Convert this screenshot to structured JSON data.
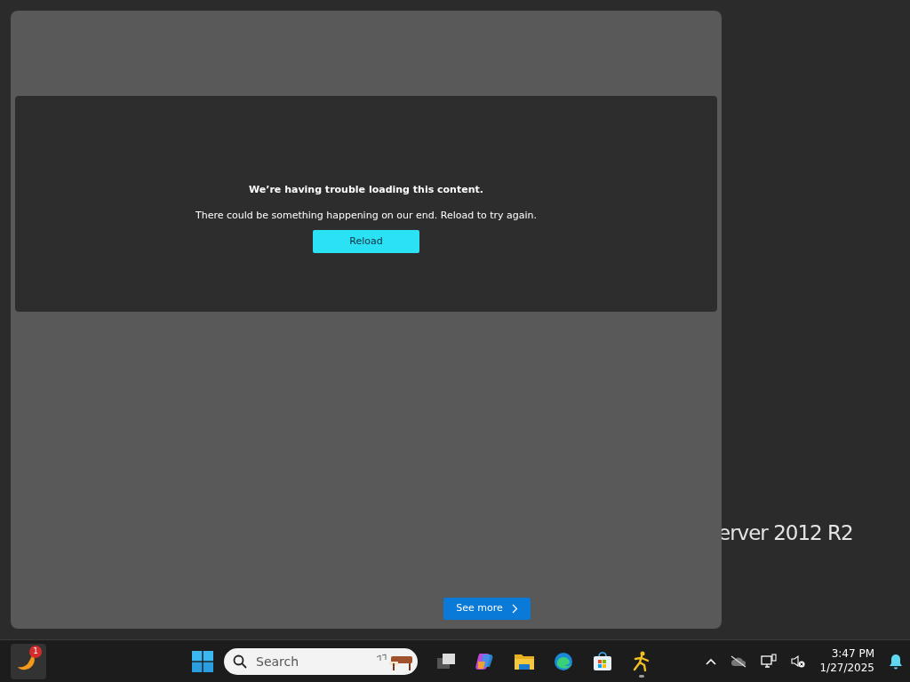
{
  "desktop": {
    "wallpaper_text": "erver 2012 R2"
  },
  "panel": {
    "error_title": "We’re having trouble loading this content.",
    "error_message": "There could be something happening on our end. Reload to try again.",
    "reload_button": "Reload",
    "see_more_button": "See more"
  },
  "taskbar": {
    "pinned_badge": "1",
    "search": {
      "placeholder": "Search"
    },
    "apps": [
      {
        "kind": "taskview",
        "running": false
      },
      {
        "kind": "copilot",
        "running": false
      },
      {
        "kind": "folder",
        "running": false
      },
      {
        "kind": "edge",
        "running": false
      },
      {
        "kind": "store",
        "running": false
      },
      {
        "kind": "runner",
        "running": true
      }
    ],
    "time": "3:47 PM",
    "date": "1/27/2025"
  }
}
